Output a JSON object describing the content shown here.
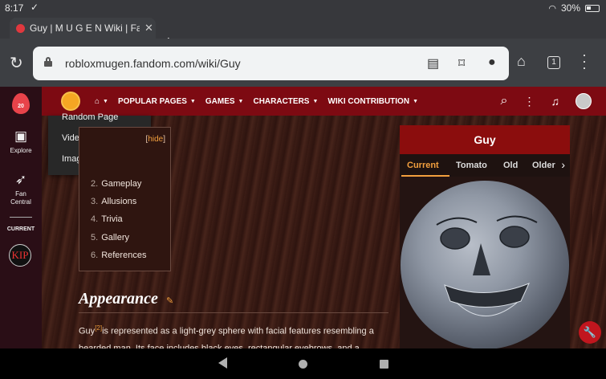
{
  "status_bar": {
    "time": "8:17",
    "battery": "30%"
  },
  "browser": {
    "tab_title": "Guy | M U G E N Wiki | Fandom",
    "url": "robloxmugen.fandom.com/wiki/Guy",
    "tab_count": "1"
  },
  "rail": {
    "explore": "Explore",
    "fan_central": "Fan Central",
    "current": "CURRENT",
    "logo_text": "20",
    "kip": "KIP"
  },
  "wiki_nav": {
    "items": [
      "POPULAR PAGES",
      "GAMES",
      "CHARACTERS",
      "WIKI CONTRIBUTION"
    ]
  },
  "dropdown": {
    "items": [
      "Random Page",
      "Videos",
      "Images"
    ]
  },
  "toc": {
    "hide_open": "[",
    "hide_label": "hide",
    "hide_close": "]",
    "items": [
      {
        "num": "2.",
        "label": "Gameplay"
      },
      {
        "num": "3.",
        "label": "Allusions"
      },
      {
        "num": "4.",
        "label": "Trivia"
      },
      {
        "num": "5.",
        "label": "Gallery"
      },
      {
        "num": "6.",
        "label": "References"
      }
    ]
  },
  "article": {
    "heading": "Appearance",
    "para_word": "Guy",
    "para_ref": "[2]",
    "para_rest": "is represented as a light-grey sphere with facial features resembling a bearded man. Its face includes black eyes, rectangular eyebrows, and a"
  },
  "infobox": {
    "title": "Guy",
    "tabs": [
      "Current",
      "Tomato",
      "Old",
      "Older"
    ]
  },
  "colors": {
    "accent": "#f29f3e",
    "wiki_nav": "#7d0a12",
    "infobox_title": "#8b0d0d"
  }
}
